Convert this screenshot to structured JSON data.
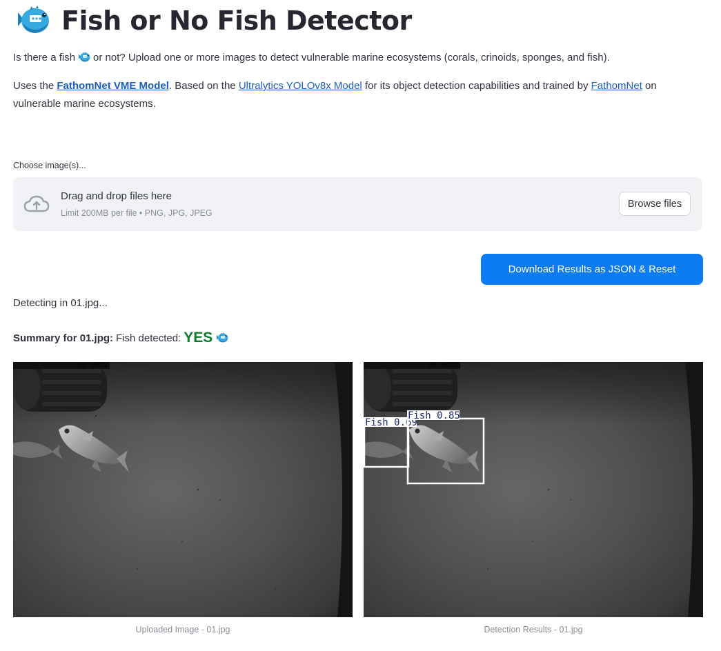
{
  "header": {
    "title": "Fish or No Fish Detector",
    "title_icon": "blowfish-icon"
  },
  "intro": {
    "part1": "Is there a fish",
    "part2": "or not? Upload one or more images to detect vulnerable marine ecosystems (corals, crinoids, sponges, and fish).",
    "inline_icon": "blowfish-icon"
  },
  "credits": {
    "uses": "Uses the",
    "model_link": "FathomNet VME Model",
    "based_on": ". Based on the",
    "yolo_link": "Ultralytics YOLOv8x Model",
    "trained_by": "for its object detection capabilities and trained by",
    "fathomnet_link": "FathomNet",
    "ending": "on vulnerable marine ecosystems."
  },
  "uploader": {
    "label": "Choose image(s)...",
    "drop_title": "Drag and drop files here",
    "drop_limit": "Limit 200MB per file • PNG, JPG, JPEG",
    "browse_label": "Browse files",
    "icon": "cloud-upload-icon"
  },
  "actions": {
    "download_label": "Download Results as JSON & Reset"
  },
  "status": {
    "detecting": "Detecting in 01.jpg..."
  },
  "summary": {
    "label": "Summary for 01.jpg:",
    "text": "Fish detected:",
    "result": "YES",
    "icon": "blowfish-icon"
  },
  "images": {
    "uploaded_caption": "Uploaded Image - 01.jpg",
    "detection_caption": "Detection Results - 01.jpg",
    "detections": [
      {
        "label": "Fish 0.69"
      },
      {
        "label": "Fish 0.85"
      }
    ]
  },
  "colors": {
    "accent": "#0d7cf2",
    "link": "#1c5fb8",
    "yes": "#0e7b2c",
    "box": "#ffffff",
    "box_label": "#1a2a6c"
  }
}
